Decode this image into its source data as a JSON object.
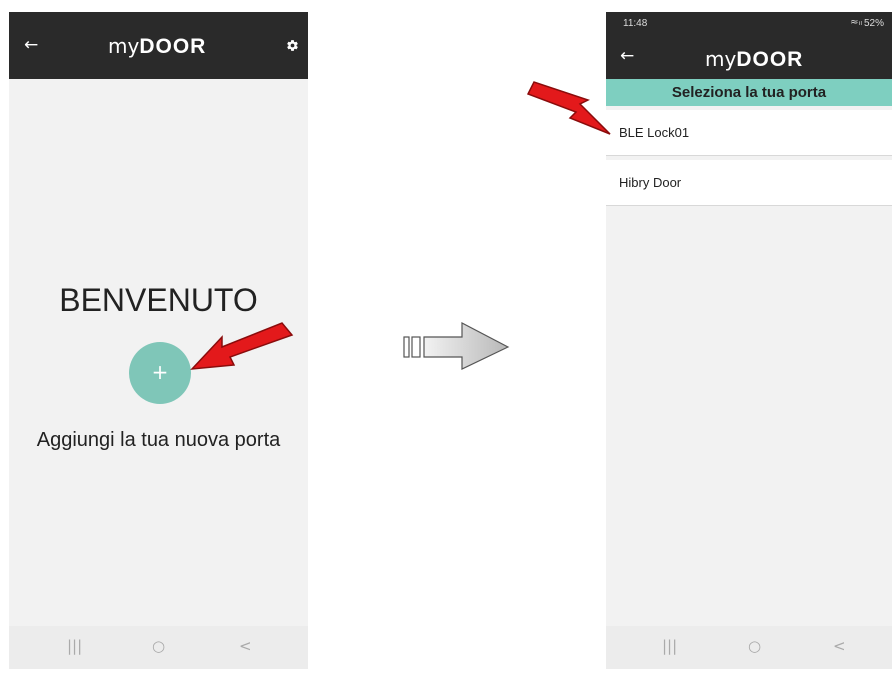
{
  "left_screen": {
    "appbar": {
      "back_icon": "arrow-left-icon",
      "logo_prefix": "my",
      "logo_main": "DOOR",
      "settings_icon": "gear-icon"
    },
    "welcome_title": "BENVENUTO",
    "add_button_symbol": "+",
    "add_label": "Aggiungi la tua nuova porta",
    "navbar": {
      "recent": "|||",
      "home": "○",
      "back": "<"
    }
  },
  "transition_arrow_icon": "arrow-right-icon",
  "right_screen": {
    "status": {
      "time": "11:48",
      "right": "52%"
    },
    "appbar": {
      "back_icon": "arrow-left-icon",
      "logo_prefix": "my",
      "logo_main": "DOOR"
    },
    "section_header": "Seleziona la tua porta",
    "doors": [
      {
        "name": "BLE Lock01"
      },
      {
        "name": "Hibry Door"
      }
    ],
    "navbar": {
      "recent": "|||",
      "home": "○",
      "back": "<"
    }
  },
  "colors": {
    "appbar": "#2a2a2a",
    "accent_teal": "#7ecfc0",
    "fab": "#7fc6b8",
    "pointer_red": "#e3191b"
  }
}
